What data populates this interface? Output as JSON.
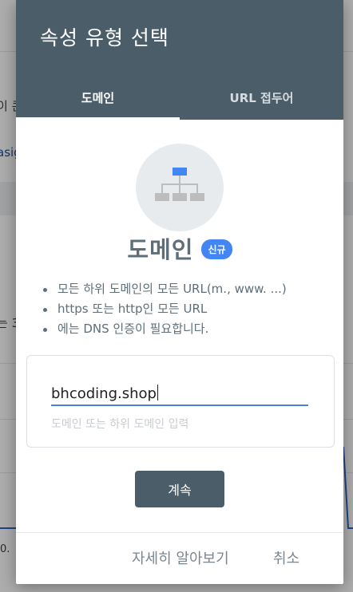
{
  "background": {
    "fragments": [
      "이 콘",
      "asig",
      "는 3",
      "0."
    ]
  },
  "dialog": {
    "title": "속성 유형 선택",
    "tabs": [
      {
        "label": "도메인",
        "active": true
      },
      {
        "label": "URL 접두어",
        "active": false
      }
    ],
    "property_type": {
      "icon": "domain-hierarchy-icon",
      "title": "도메인",
      "badge": "신규"
    },
    "features": [
      "모든 하위 도메인의 모든 URL(m., www. ...)",
      "https 또는 http인 모든 URL",
      "에는 DNS 인증이 필요합니다."
    ],
    "input": {
      "value": "bhcoding.shop",
      "hint": "도메인 또는 하위 도메인 입력"
    },
    "continue_label": "계속",
    "footer": {
      "learn_more": "자세히 알아보기",
      "cancel": "취소"
    }
  },
  "colors": {
    "header": "#4b5d68",
    "badge": "#4285f4",
    "input_focus": "#4a7fdc",
    "button": "#4b5d68"
  }
}
